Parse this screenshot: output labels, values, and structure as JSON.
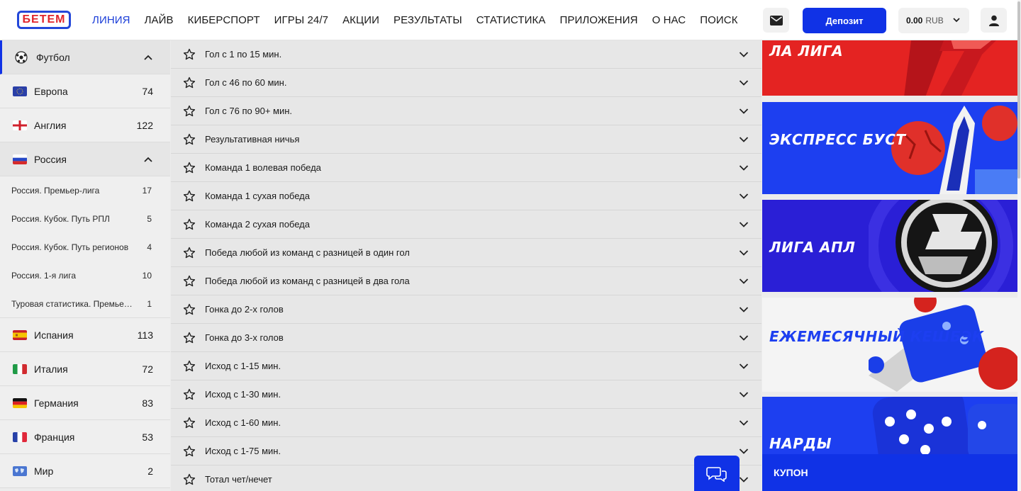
{
  "header": {
    "logo_text": "БЕТЕМ",
    "nav": [
      "ЛИНИЯ",
      "ЛАЙВ",
      "КИБЕРСПОРТ",
      "ИГРЫ 24/7",
      "АКЦИИ",
      "РЕЗУЛЬТАТЫ",
      "СТАТИСТИКА",
      "ПРИЛОЖЕНИЯ",
      "О НАС",
      "ПОИСК"
    ],
    "active_nav": "ЛИНИЯ",
    "deposit_label": "Депозит",
    "balance_amount": "0.00",
    "balance_currency": "RUB",
    "accent_color": "#1032e6"
  },
  "sidebar": {
    "sport": "Футбол",
    "countries_top": [
      {
        "label": "Европа",
        "count": "74",
        "flag": "eu-flag-icon"
      },
      {
        "label": "Англия",
        "count": "122",
        "flag": "england-flag-icon"
      }
    ],
    "expanded_country": {
      "label": "Россия",
      "flag": "russia-flag-icon"
    },
    "leagues": [
      {
        "label": "Россия. Премьер-лига",
        "count": "17"
      },
      {
        "label": "Россия. Кубок. Путь РПЛ",
        "count": "5"
      },
      {
        "label": "Россия. Кубок. Путь регионов",
        "count": "4"
      },
      {
        "label": "Россия. 1-я лига",
        "count": "10"
      },
      {
        "label": "Туровая статистика. Премьер-лига",
        "count": "1"
      }
    ],
    "countries_bottom": [
      {
        "label": "Испания",
        "count": "113",
        "flag": "spain-flag-icon"
      },
      {
        "label": "Италия",
        "count": "72",
        "flag": "italy-flag-icon"
      },
      {
        "label": "Германия",
        "count": "83",
        "flag": "germany-flag-icon"
      },
      {
        "label": "Франция",
        "count": "53",
        "flag": "france-flag-icon"
      },
      {
        "label": "Мир",
        "count": "2",
        "flag": "world-flag-icon"
      }
    ]
  },
  "markets": [
    "Гол с 1 по 15 мин.",
    "Гол с 46 по 60 мин.",
    "Гол с 76 по 90+ мин.",
    "Результативная ничья",
    "Команда 1 волевая победа",
    "Команда 1 сухая победа",
    "Команда 2 сухая победа",
    "Победа любой из команд с разницей в один гол",
    "Победа любой из команд с разницей в два гола",
    "Гонка до 2-х голов",
    "Гонка до 3-х голов",
    "Исход с 1-15 мин.",
    "Исход с 1-30 мин.",
    "Исход с 1-60 мин.",
    "Исход с 1-75 мин.",
    "Тотал чет/нечет"
  ],
  "promos": [
    {
      "title": "ЛА ЛИГА",
      "color": "#e42322"
    },
    {
      "title": "ЭКСПРЕСС БУСТ",
      "color": "#1d3ff0"
    },
    {
      "title": "ЛИГА АПЛ",
      "color": "#2a1fd6"
    },
    {
      "title": "ЕЖЕМЕСЯЧНЫЙ КЕШБЭК",
      "color": "#1032e6"
    },
    {
      "title": "НАРДЫ",
      "color": "#1d3ff0"
    }
  ],
  "coupon_label": "КУПОН"
}
